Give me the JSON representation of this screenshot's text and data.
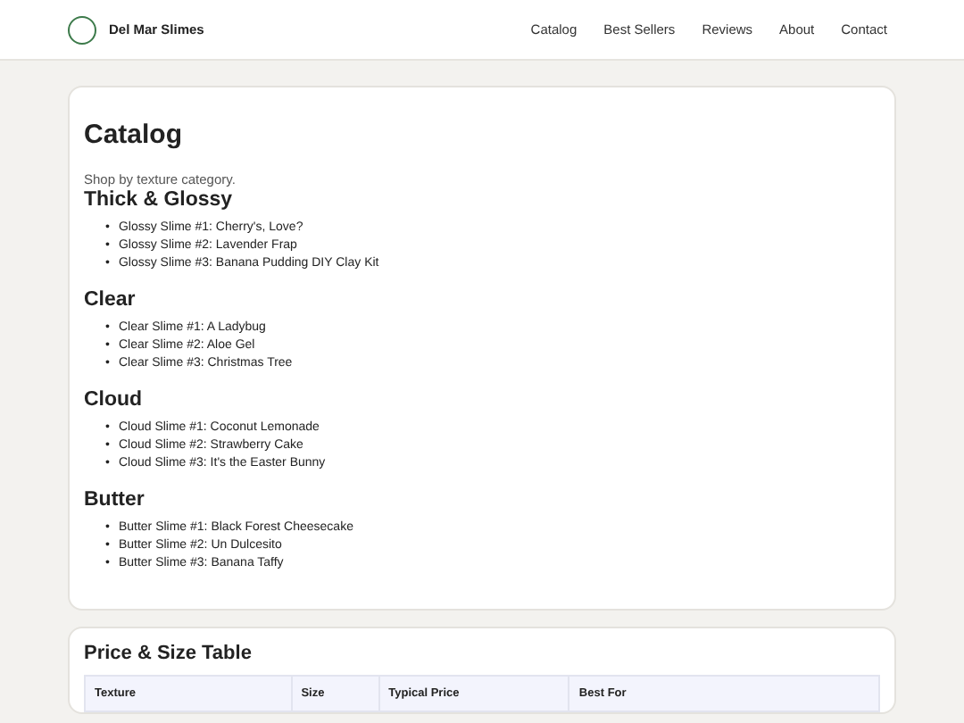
{
  "header": {
    "brand": "Del Mar Slimes",
    "nav": [
      {
        "label": "Catalog"
      },
      {
        "label": "Best Sellers"
      },
      {
        "label": "Reviews"
      },
      {
        "label": "About"
      },
      {
        "label": "Contact"
      }
    ]
  },
  "catalog": {
    "title": "Catalog",
    "intro": "Shop by texture category.",
    "categories": [
      {
        "name": "Thick & Glossy",
        "items": [
          {
            "marker": "•",
            "text": "Glossy Slime #1: Cherry's, Love?"
          },
          {
            "marker": "•",
            "text": "Glossy Slime #2: Lavender Frap"
          },
          {
            "marker": "•",
            "text": "Glossy Slime #3: Banana Pudding DIY Clay Kit"
          }
        ]
      },
      {
        "name": "Clear",
        "items": [
          {
            "marker": "•",
            "text": "Clear Slime #1: A Ladybug"
          },
          {
            "marker": "•",
            "text": "Clear Slime #2: Aloe Gel"
          },
          {
            "marker": "•",
            "text": "Clear Slime #3: Christmas Tree"
          }
        ]
      },
      {
        "name": "Cloud",
        "items": [
          {
            "marker": "•",
            "text": "Cloud Slime #1: Coconut Lemonade"
          },
          {
            "marker": "•",
            "text": "Cloud Slime #2: Strawberry Cake"
          },
          {
            "marker": "•",
            "text": "Cloud Slime #3: It's the Easter Bunny"
          }
        ]
      },
      {
        "name": "Butter",
        "items": [
          {
            "marker": "•",
            "text": "Butter Slime #1: Black Forest Cheesecake"
          },
          {
            "marker": "•",
            "text": "Butter Slime #2: Un Dulcesito"
          },
          {
            "marker": "•",
            "text": "Butter Slime #3: Banana Taffy"
          }
        ]
      }
    ]
  },
  "price_table": {
    "title": "Price & Size Table",
    "columns": [
      "Texture",
      "Size",
      "Typical Price",
      "Best For"
    ]
  }
}
